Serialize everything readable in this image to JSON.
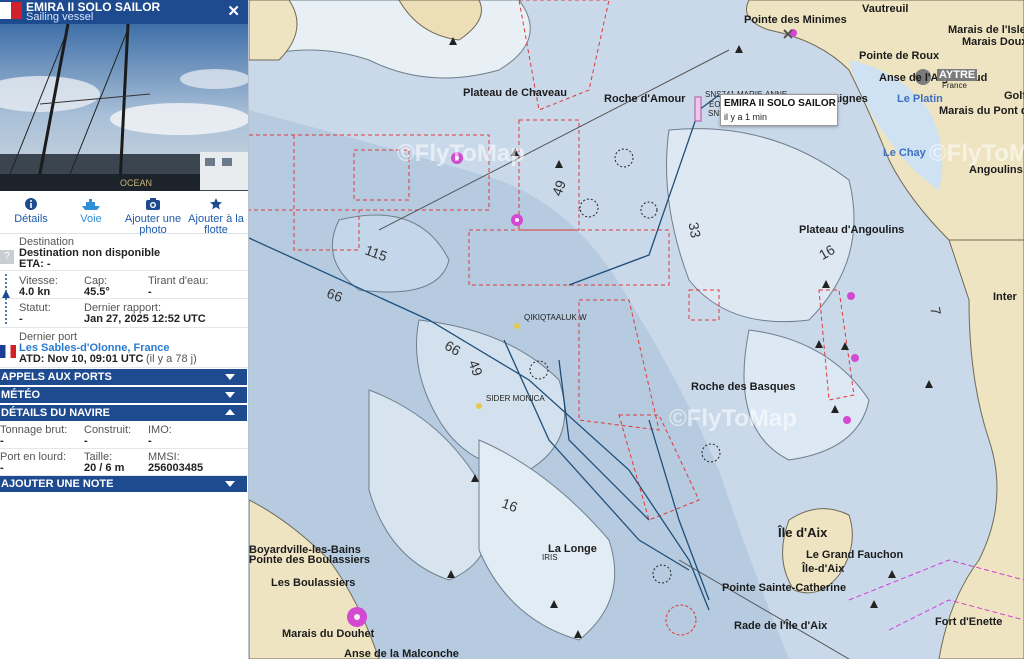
{
  "vessel": {
    "name": "EMIRA II SOLO SAILOR",
    "type": "Sailing vessel",
    "flag_color": "#d0202e"
  },
  "tabs": [
    {
      "label": "Détails",
      "icon": "info-icon"
    },
    {
      "label": "Voie",
      "icon": "ship-icon"
    },
    {
      "label": "Ajouter une photo",
      "icon": "camera-icon"
    },
    {
      "label": "Ajouter à la flotte",
      "icon": "star-icon"
    }
  ],
  "destination": {
    "label": "Destination",
    "value": "Destination non disponible",
    "eta": "ETA: -"
  },
  "voyage": {
    "speed_label": "Vitesse:",
    "speed": "4.0 kn",
    "course_label": "Cap:",
    "course": "45.5°",
    "draft_label": "Tirant d'eau:",
    "draft": "-",
    "status_label": "Statut:",
    "status": "-",
    "report_label": "Dernier rapport:",
    "report": "Jan 27, 2025 12:52 UTC"
  },
  "last_port": {
    "label": "Dernier port",
    "name": "Les Sables-d'Olonne, France",
    "atd": "ATD: Nov 10, 09:01 UTC",
    "ago": "(il y a 78 j)"
  },
  "sections": {
    "port_calls": "APPELS AUX PORTS",
    "weather": "MÉTÉO",
    "details": "DÉTAILS DU NAVIRE",
    "note": "AJOUTER UNE NOTE"
  },
  "ship_details": {
    "gt_label": "Tonnage brut:",
    "gt": "-",
    "built_label": "Construit:",
    "built": "-",
    "imo_label": "IMO:",
    "imo": "-",
    "dwt_label": "Port en lourd:",
    "dwt": "-",
    "size_label": "Taille:",
    "size": "20 / 6 m",
    "mmsi_label": "MMSI:",
    "mmsi": "256003485"
  },
  "map": {
    "tooltip_name": "EMIRA II SOLO SAILOR",
    "tooltip_time": "il y a 1 min",
    "watermark": "©FlyToMap",
    "places": {
      "vautreuil": "Vautreuil",
      "pointe_minimes": "Pointe des Minimes",
      "marais_fr": "Marais de l'Isle-",
      "pointe_roux": "Pointe de Roux",
      "marais_doux": "Marais Doux",
      "anse": "Anse de l'Aiguchaud",
      "aytre": "AYTRE",
      "france": "France",
      "le_platin": "Le Platin",
      "marais_pont": "Marais du Pont de l'",
      "aignes": "aignes",
      "golf": "Golf",
      "chaveau": "Plateau de Chaveau",
      "roche_amour": "Roche d'Amour",
      "le_chay": "Le Chay",
      "angoulins": "Angoulins",
      "plateau_angoulins": "Plateau d'Angoulins",
      "inter": "Inter",
      "roche_basques": "Roche des Basques",
      "ile_aix": "Île d'Aix",
      "grand_fauchon": "Le Grand Fauchon",
      "ile_aix_town": "Île-d'Aix",
      "pointe_catherine": "Pointe Sainte-Catherine",
      "rade": "Rade de l'Île d'Aix",
      "fort_enette": "Fort d'Enette",
      "la_longe": "La Longe",
      "bains": "Boyardville-les-Bains",
      "boulassiers": "Pointe des Boulassiers",
      "les_boulassiers": "Les Boulassiers",
      "douhet": "Marais du Douhet",
      "malconche": "Anse de la Malconche"
    },
    "depths": [
      "115",
      "66",
      "66",
      "49",
      "49",
      "16",
      "16",
      "33",
      "7"
    ],
    "small_labels": {
      "qikiq": "QIKIQTAALUK W",
      "sider": "SIDER MONICA",
      "sns1": "SNS741 MARIE-ANNE",
      "sns2": "SNS",
      "eol": "EOL",
      "iris": "IRIS"
    }
  }
}
